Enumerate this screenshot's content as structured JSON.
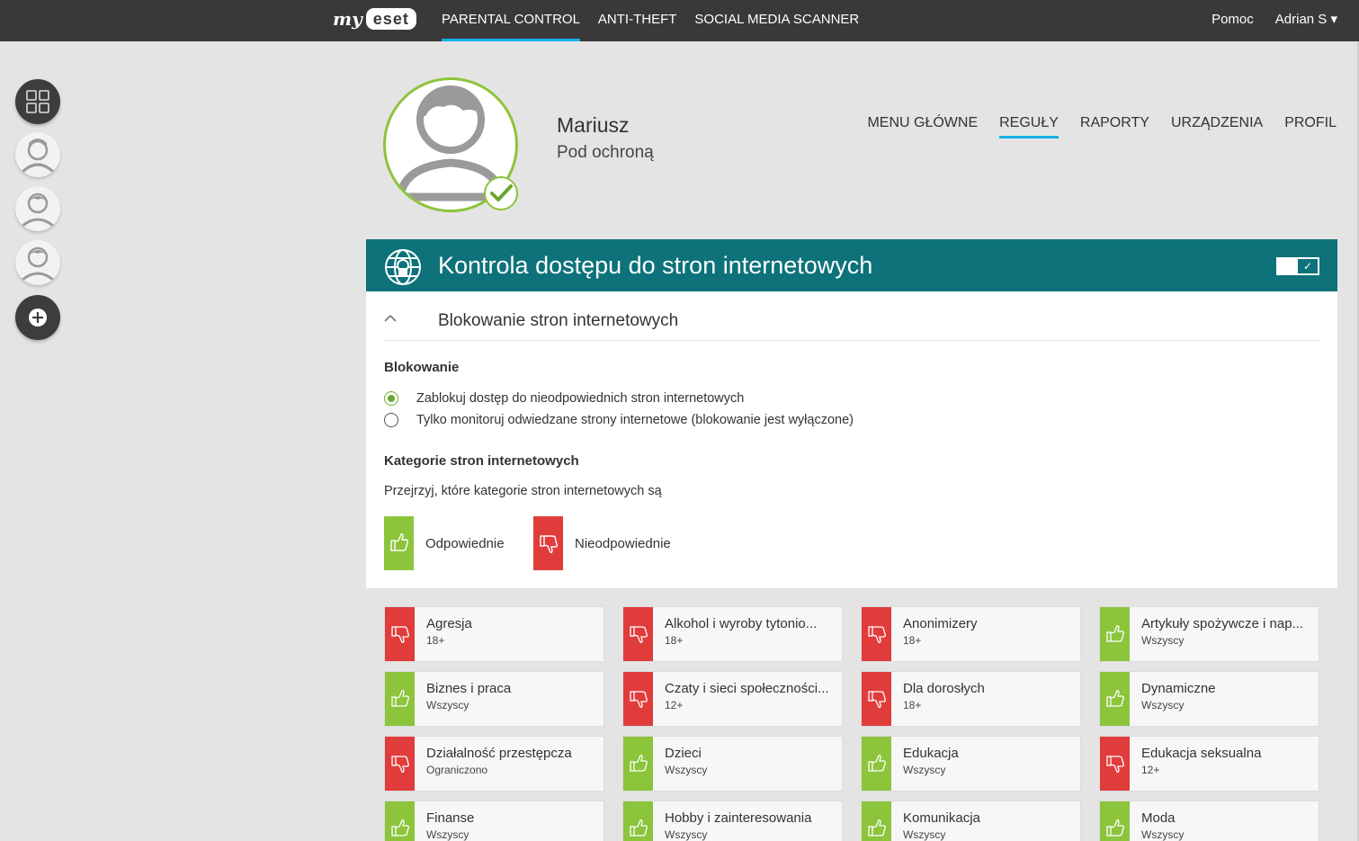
{
  "topbar": {
    "logo_my": "my",
    "logo_eset": "eset",
    "nav": [
      "PARENTAL CONTROL",
      "ANTI-THEFT",
      "SOCIAL MEDIA SCANNER"
    ],
    "help": "Pomoc",
    "user": "Adrian S ▾"
  },
  "profile": {
    "name": "Mariusz",
    "status": "Pod ochroną"
  },
  "subnav": [
    "MENU GŁÓWNE",
    "REGUŁY",
    "RAPORTY",
    "URZĄDZENIA",
    "PROFIL"
  ],
  "section": {
    "title": "Kontrola dostępu do stron internetowych",
    "toggle_on": true,
    "toggle_mark": "✓"
  },
  "blocking": {
    "collapse_title": "Blokowanie stron internetowych",
    "heading": "Blokowanie",
    "options": [
      "Zablokuj dostęp do nieodpowiednich stron internetowych",
      "Tylko monitoruj odwiedzane strony internetowe (blokowanie jest wyłączone)"
    ],
    "selected_index": 0
  },
  "categories_section": {
    "heading": "Kategorie stron internetowych",
    "description": "Przejrzyj, które kategorie stron internetowych są",
    "legend_ok": "Odpowiednie",
    "legend_bad": "Nieodpowiednie"
  },
  "colors": {
    "ok": "#8cc43c",
    "bad": "#e03c3c",
    "teal": "#0d727a",
    "accent": "#16b0e8"
  },
  "categories": [
    {
      "name": "Agresja",
      "age": "18+",
      "status": "bad"
    },
    {
      "name": "Alkohol i wyroby tytonio...",
      "age": "18+",
      "status": "bad"
    },
    {
      "name": "Anonimizery",
      "age": "18+",
      "status": "bad"
    },
    {
      "name": "Artykuły spożywcze i nap...",
      "age": "Wszyscy",
      "status": "ok"
    },
    {
      "name": "Biznes i praca",
      "age": "Wszyscy",
      "status": "ok"
    },
    {
      "name": "Czaty i sieci społeczności...",
      "age": "12+",
      "status": "bad"
    },
    {
      "name": "Dla dorosłych",
      "age": "18+",
      "status": "bad"
    },
    {
      "name": "Dynamiczne",
      "age": "Wszyscy",
      "status": "ok"
    },
    {
      "name": "Działalność przestępcza",
      "age": "Ograniczono",
      "status": "bad"
    },
    {
      "name": "Dzieci",
      "age": "Wszyscy",
      "status": "ok"
    },
    {
      "name": "Edukacja",
      "age": "Wszyscy",
      "status": "ok"
    },
    {
      "name": "Edukacja seksualna",
      "age": "12+",
      "status": "bad"
    },
    {
      "name": "Finanse",
      "age": "Wszyscy",
      "status": "ok"
    },
    {
      "name": "Hobby i zainteresowania",
      "age": "Wszyscy",
      "status": "ok"
    },
    {
      "name": "Komunikacja",
      "age": "Wszyscy",
      "status": "ok"
    },
    {
      "name": "Moda",
      "age": "Wszyscy",
      "status": "ok"
    }
  ]
}
